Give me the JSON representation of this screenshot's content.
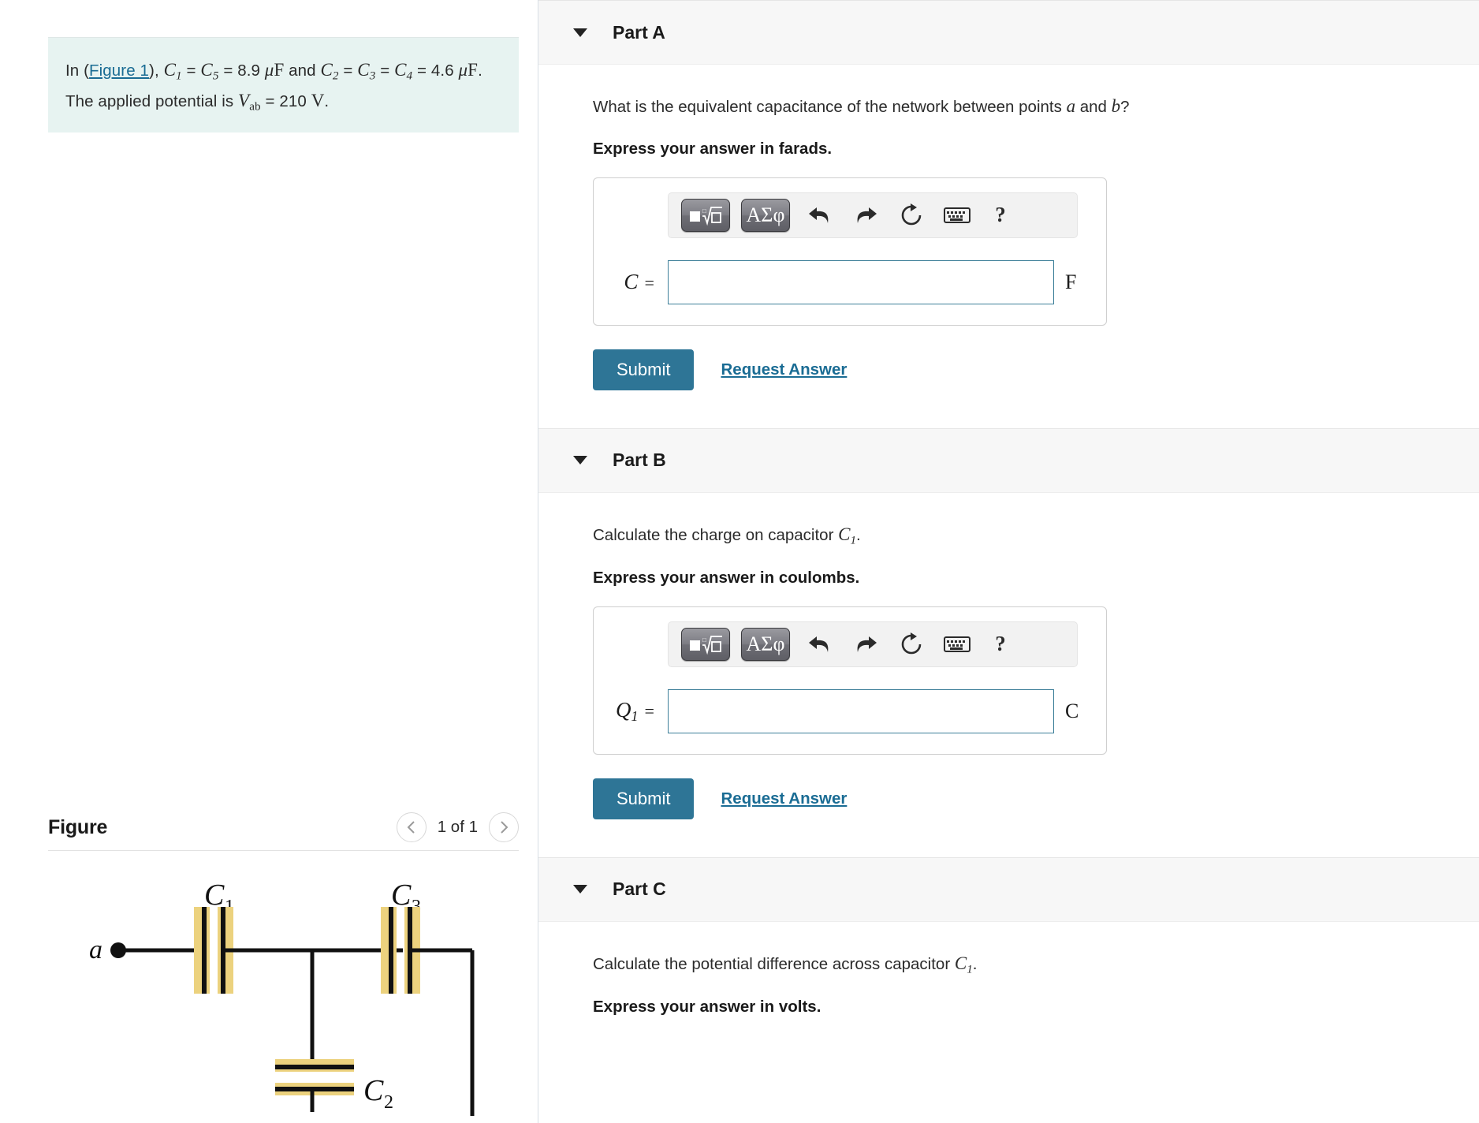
{
  "problem": {
    "prefix": "In (",
    "figure_link": "Figure 1",
    "segment_after_link": "), ",
    "c1": "C",
    "c1_sub": "1",
    "eq1": " = ",
    "c5": "C",
    "c5_sub": "5",
    "eq2": " = ",
    "val1": "8.9 ",
    "unit1": "μF",
    "and_text": " and ",
    "c2": "C",
    "c2_sub": "2",
    "eq3": " = ",
    "c3": "C",
    "c3_sub": "3",
    "eq4": " = ",
    "c4": "C",
    "c4_sub": "4",
    "eq5": " = ",
    "val2": "4.6 ",
    "unit2": "μF",
    "sentence2": ". The applied potential is ",
    "vab": "V",
    "vab_sub": "ab",
    "eq6": " = ",
    "val3": "210 ",
    "unit3": "V",
    "period": ".",
    "full_text": "In (Figure 1), C₁ = C₅ = 8.9 μF and C₂ = C₃ = C₄ = 4.6 μF. The applied potential is V_ab = 210 V.",
    "background_color": "#e7f3f1"
  },
  "figure_panel": {
    "title": "Figure",
    "prev_icon": "chevron-left-icon",
    "next_icon": "chevron-right-icon",
    "count_label": "1 of 1",
    "circuit": {
      "node_a_label": "a",
      "capacitors": [
        {
          "id": "C",
          "sub": "1"
        },
        {
          "id": "C",
          "sub": "3"
        },
        {
          "id": "C",
          "sub": "2"
        }
      ],
      "plate_color": "#ecd27e",
      "wire_color": "#1a1a1a"
    }
  },
  "toolbar": {
    "sqrt_button_name": "template-math-button",
    "greek_label": "ΑΣφ",
    "undo_icon": "undo-arrow-icon",
    "redo_icon": "redo-arrow-icon",
    "reset_icon": "reset-circular-arrow-icon",
    "keyboard_icon": "keyboard-icon",
    "help_label": "?"
  },
  "parts": [
    {
      "id": "part-a",
      "header": "Part A",
      "caret_icon": "caret-down-icon",
      "question_pre": "What is the equivalent capacitance of the network between points ",
      "question_var1": "a",
      "question_mid": " and ",
      "question_var2": "b",
      "question_post": "?",
      "express": "Express your answer in farads.",
      "var_symbol": "C",
      "var_sub": "",
      "equals": "=",
      "input_value": "",
      "input_placeholder": "",
      "unit": "F",
      "submit_label": "Submit",
      "request_label": "Request Answer"
    },
    {
      "id": "part-b",
      "header": "Part B",
      "caret_icon": "caret-down-icon",
      "question_pre": "Calculate the charge on capacitor ",
      "question_var1": "C",
      "question_var1_sub": "1",
      "question_post": ".",
      "express": "Express your answer in coulombs.",
      "var_symbol": "Q",
      "var_sub": "1",
      "equals": "=",
      "input_value": "",
      "input_placeholder": "",
      "unit": "C",
      "submit_label": "Submit",
      "request_label": "Request Answer"
    },
    {
      "id": "part-c",
      "header": "Part C",
      "caret_icon": "caret-down-icon",
      "question_pre": "Calculate the potential difference across capacitor ",
      "question_var1": "C",
      "question_var1_sub": "1",
      "question_post": ".",
      "express": "Express your answer in volts."
    }
  ],
  "colors": {
    "accent": "#2e7596",
    "link": "#1a6c94",
    "input_border": "#3d7f99",
    "panel_header_bg": "#f7f7f7",
    "problem_bg": "#e7f3f1"
  }
}
